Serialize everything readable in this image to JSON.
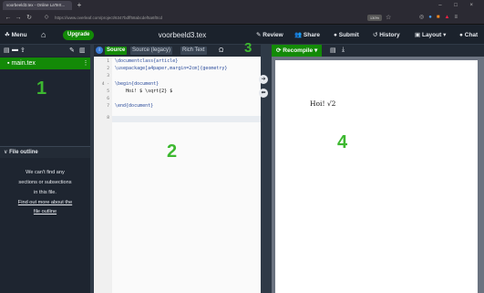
{
  "browser": {
    "tab_title": "voorbeeld3.tex - Online LaTeX...",
    "new_tab": "+",
    "url": "https://www.overleaf.com/project/6347bdff58abcdef5a6f0cd",
    "zoom": "130%",
    "window_controls": "– □ ×"
  },
  "toolbar": {
    "menu": "Menu",
    "home_icon": "home-icon",
    "upgrade": "Upgrade",
    "title": "voorbeeld3.tex",
    "review": "Review",
    "share": "Share",
    "submit": "Submit",
    "history": "History",
    "layout": "Layout",
    "chat": "Chat"
  },
  "file_tree": {
    "file": "main.tex",
    "marker": "1"
  },
  "outline": {
    "header": "File outline",
    "empty_lines": [
      "We can't find any",
      "sections or subsections",
      "in this file."
    ],
    "link_lines": [
      "Find out more about the",
      "file outline"
    ]
  },
  "editor": {
    "source": "Source",
    "source_legacy": "Source (legacy)",
    "rich_text": "Rich Text",
    "omega": "Ω",
    "marker_toolbar": "3",
    "marker": "2",
    "lines": [
      {
        "n": "1",
        "text": "\\documentclass{article}"
      },
      {
        "n": "2",
        "text": "\\usepackage[a4paper,margin=2cm]{geometry}"
      },
      {
        "n": "3",
        "text": ""
      },
      {
        "n": "4 -",
        "text": "\\begin{document}"
      },
      {
        "n": "5",
        "text": "    Hoi! $ \\sqrt{2} $"
      },
      {
        "n": "6",
        "text": ""
      },
      {
        "n": "7",
        "text": "\\end{document}"
      },
      {
        "n": "8",
        "text": ""
      }
    ]
  },
  "pdf": {
    "recompile": "Recompile",
    "rendered_text": "Hoi! √2",
    "marker": "4"
  },
  "colors": {
    "accent_green": "#138a07",
    "marker_green": "#3db830",
    "dark_bg": "#1b222c"
  }
}
